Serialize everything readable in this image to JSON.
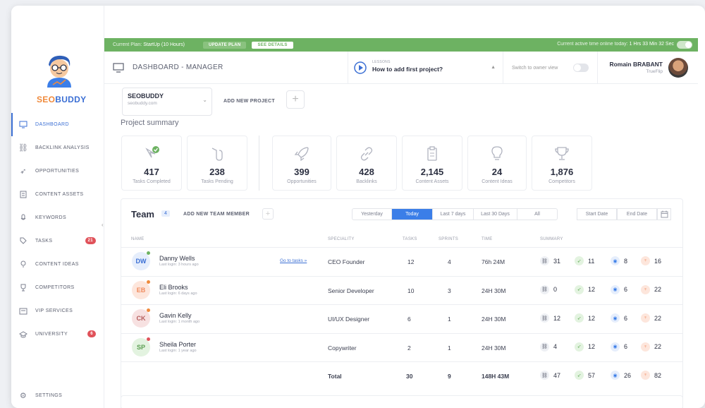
{
  "window": {
    "traffic_colors": [
      "#f25d5d",
      "#f3b74a",
      "#5fc25b"
    ]
  },
  "brand": {
    "name_part1": "SEO",
    "name_part2": "BUDDY",
    "color1": "#f08a3c",
    "color2": "#3b6fd4"
  },
  "sidebar": {
    "items": [
      {
        "label": "DASHBOARD",
        "icon": "monitor-icon"
      },
      {
        "label": "BACKLINK ANALYSIS",
        "icon": "link-icon"
      },
      {
        "label": "OPPORTUNITIES",
        "icon": "rocket-icon"
      },
      {
        "label": "CONTENT ASSETS",
        "icon": "document-icon"
      },
      {
        "label": "KEYWORDS",
        "icon": "microphone-icon"
      },
      {
        "label": "TASKS",
        "icon": "tag-icon",
        "badge": "21"
      },
      {
        "label": "CONTENT IDEAS",
        "icon": "bulb-icon"
      },
      {
        "label": "COMPETITORS",
        "icon": "trophy-icon"
      },
      {
        "label": "VIP SERVICES",
        "icon": "vip-icon"
      },
      {
        "label": "UNIVERSITY",
        "icon": "graduation-icon",
        "badge": "6"
      }
    ],
    "settings_label": "SETTINGS"
  },
  "topbar": {
    "plan_label": "Current Plan:",
    "plan_value": "StartUp (10 Hours)",
    "update_plan": "UPDATE PLAN",
    "see_details": "SEE DETAILS",
    "active_time_label": "Current active time online today:",
    "active_time_value": "1 Hrs 33 Min 32 Sec",
    "color": "#6db262"
  },
  "header": {
    "title": "DASHBOARD - MANAGER",
    "lessons_label": "LESSONS",
    "lesson_title": "How to add first project?",
    "switch_label": "Switch to owner view",
    "user_name": "Romain BRABANT",
    "user_company": "TrueFlip"
  },
  "project": {
    "name": "SEOBUDDY",
    "url": "seobuddy.com",
    "add_new": "ADD NEW PROJECT"
  },
  "summary": {
    "title": "Project summary",
    "cards": [
      {
        "value": "417",
        "label": "Tasks Completed",
        "icon": "mouse-check-icon"
      },
      {
        "value": "238",
        "label": "Tasks Pending",
        "icon": "mouse-icon"
      },
      {
        "value": "399",
        "label": "Opportunities",
        "icon": "rocket-icon"
      },
      {
        "value": "428",
        "label": "Backlinks",
        "icon": "link-icon"
      },
      {
        "value": "2,145",
        "label": "Content Assets",
        "icon": "clipboard-icon"
      },
      {
        "value": "24",
        "label": "Content Ideas",
        "icon": "bulb-icon"
      },
      {
        "value": "1,876",
        "label": "Competitors",
        "icon": "trophy-icon"
      }
    ]
  },
  "team": {
    "title": "Team",
    "count": "4",
    "add_member": "ADD NEW TEAM MEMBER",
    "ranges": [
      "Yesterday",
      "Today",
      "Last 7 days",
      "Last 30 Days",
      "All"
    ],
    "active_range": "Today",
    "start_date": "Start Date",
    "end_date": "End Date",
    "columns": [
      "NAME",
      "SPECIALITY",
      "TASKS",
      "SPRINTS",
      "TIME",
      "SUMMARY"
    ],
    "goto_label": "Go to tasks »",
    "members": [
      {
        "initials": "DW",
        "name": "Danny Wells",
        "last_login": "Last login: 3 hours ago",
        "speciality": "CEO Founder",
        "tasks": "12",
        "sprints": "4",
        "time": "76h 24M",
        "s1": "31",
        "s2": "11",
        "s3": "8",
        "s4": "16",
        "avatar_bg": "#e6eefc",
        "avatar_fg": "#3b6fd4",
        "status": "#6db262"
      },
      {
        "initials": "EB",
        "name": "Eli Brooks",
        "last_login": "Last login: 6 days ago",
        "speciality": "Senior Developer",
        "tasks": "10",
        "sprints": "3",
        "time": "24H 30M",
        "s1": "0",
        "s2": "12",
        "s3": "6",
        "s4": "22",
        "avatar_bg": "#fde6dc",
        "avatar_fg": "#f08a5d",
        "status": "#f08a3c"
      },
      {
        "initials": "CK",
        "name": "Gavin Kelly",
        "last_login": "Last login: 1 month ago",
        "speciality": "UI/UX Designer",
        "tasks": "6",
        "sprints": "1",
        "time": "24H 30M",
        "s1": "12",
        "s2": "12",
        "s3": "6",
        "s4": "22",
        "avatar_bg": "#f7e1e1",
        "avatar_fg": "#b55b5b",
        "status": "#f08a3c"
      },
      {
        "initials": "SP",
        "name": "Sheila Porter",
        "last_login": "Last login: 1 year ago",
        "speciality": "Copywriter",
        "tasks": "2",
        "sprints": "1",
        "time": "24H 30M",
        "s1": "4",
        "s2": "12",
        "s3": "6",
        "s4": "22",
        "avatar_bg": "#e3f3e0",
        "avatar_fg": "#5a9e50",
        "status": "#e0525a"
      }
    ],
    "total": {
      "label": "Total",
      "tasks": "30",
      "sprints": "9",
      "time": "148H 43M",
      "s1": "47",
      "s2": "57",
      "s3": "26",
      "s4": "82"
    }
  }
}
